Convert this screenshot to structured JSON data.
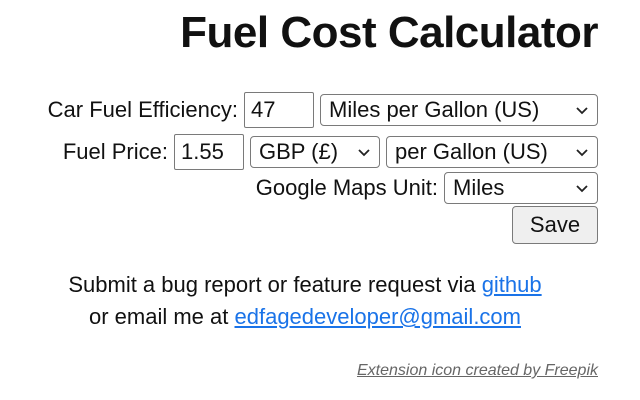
{
  "title": "Fuel Cost Calculator",
  "efficiency": {
    "label": "Car Fuel Efficiency:",
    "value": "47",
    "unit_selected": "Miles per Gallon (US)"
  },
  "price": {
    "label": "Fuel Price:",
    "value": "1.55",
    "currency_selected": "GBP (£)",
    "per_selected": "per Gallon (US)"
  },
  "maps": {
    "label": "Google Maps Unit:",
    "selected": "Miles"
  },
  "save_label": "Save",
  "footer": {
    "line1_prefix": "Submit a bug report or feature request via ",
    "github_link": "github",
    "line2_prefix": "or email me at ",
    "email_link": "edfagedeveloper@gmail.com"
  },
  "credit": "Extension icon created by Freepik",
  "icons": {
    "dropdown": "chevron-down-icon"
  },
  "colors": {
    "link": "#1a73e8",
    "text": "#111111",
    "credit": "#666666"
  }
}
